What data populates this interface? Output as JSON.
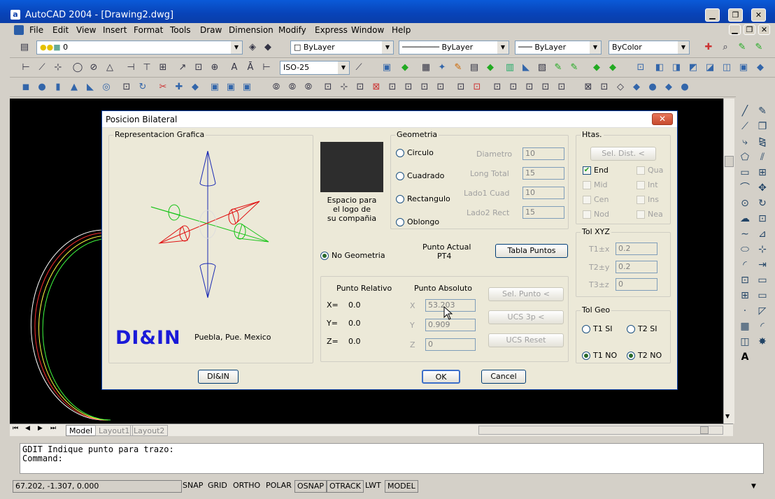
{
  "window": {
    "title": "AutoCAD 2004 - [Drawing2.dwg]",
    "icon_letter": "a"
  },
  "menu": [
    "File",
    "Edit",
    "View",
    "Insert",
    "Format",
    "Tools",
    "Draw",
    "Dimension",
    "Modify",
    "Express",
    "Window",
    "Help"
  ],
  "layer_toolbar": {
    "layer_value": "0",
    "color": "ByLayer",
    "linetype": "ByLayer",
    "lineweight": "ByLayer",
    "plotstyle": "ByColor"
  },
  "dim_style": "ISO-25",
  "dialog": {
    "title": "Posicion Bilateral",
    "close_label": "✕",
    "rep_grafica": "Representacion Grafica",
    "logo_text": "Espacio para\nel logo de\nsu compañia",
    "brand": "DI&IN",
    "location": "Puebla, Pue. Mexico",
    "geometria": {
      "label": "Geometria",
      "options": [
        "Circulo",
        "Cuadrado",
        "Rectangulo",
        "Oblongo"
      ],
      "fields": [
        {
          "label": "Diametro",
          "value": "10"
        },
        {
          "label": "Long Total",
          "value": "15"
        },
        {
          "label": "Lado1 Cuad",
          "value": "10"
        },
        {
          "label": "Lado2 Rect",
          "value": "15"
        }
      ]
    },
    "no_geometria": "No Geometria",
    "punto_actual_label": "Punto Actual",
    "punto_actual_value": "PT4",
    "tabla_puntos": "Tabla Puntos",
    "punto_relativo": "Punto Relativo",
    "punto_absoluto": "Punto Absoluto",
    "rel": [
      {
        "axis": "X=",
        "value": "0.0"
      },
      {
        "axis": "Y=",
        "value": "0.0"
      },
      {
        "axis": "Z=",
        "value": "0.0"
      }
    ],
    "abs": [
      {
        "axis": "X",
        "value": "53.203"
      },
      {
        "axis": "Y",
        "value": "0.909"
      },
      {
        "axis": "Z",
        "value": "0"
      }
    ],
    "sel_punto": "Sel. Punto <",
    "ucs3p": "UCS 3p <",
    "ucs_reset": "UCS Reset",
    "htas": {
      "label": "Htas.",
      "sel_dist": "Sel. Dist. <",
      "checks": [
        {
          "label": "End",
          "checked": true
        },
        {
          "label": "Qua",
          "checked": false
        },
        {
          "label": "Mid",
          "checked": false
        },
        {
          "label": "Int",
          "checked": false
        },
        {
          "label": "Cen",
          "checked": false
        },
        {
          "label": "Ins",
          "checked": false
        },
        {
          "label": "Nod",
          "checked": false
        },
        {
          "label": "Nea",
          "checked": false
        }
      ]
    },
    "tolxyz": {
      "label": "Tol XYZ",
      "rows": [
        {
          "label": "T1±x",
          "value": "0.2"
        },
        {
          "label": "T2±y",
          "value": "0.2"
        },
        {
          "label": "T3±z",
          "value": "0"
        }
      ]
    },
    "tolgeo": {
      "label": "Tol Geo",
      "t1si": "T1 SI",
      "t2si": "T2 SI",
      "t1no": "T1 NO",
      "t2no": "T2 NO"
    },
    "diin_button": "DI&IN",
    "ok": "OK",
    "cancel": "Cancel"
  },
  "tabs": [
    "Model",
    "Layout1",
    "Layout2"
  ],
  "command": {
    "line1": "GDIT Indique punto para trazo:",
    "line2": "Command:"
  },
  "status": {
    "coords": "67.202, -1.307, 0.000",
    "toggles": [
      "SNAP",
      "GRID",
      "ORTHO",
      "POLAR",
      "OSNAP",
      "OTRACK",
      "LWT",
      "MODEL"
    ]
  }
}
